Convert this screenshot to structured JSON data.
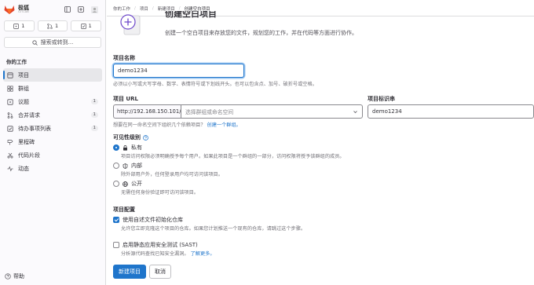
{
  "brand": {
    "name": "极狐",
    "subtitle": "GITLAB"
  },
  "sidebar": {
    "counters": [
      {
        "icon": "issues-icon",
        "count": "1"
      },
      {
        "icon": "merge-request-icon",
        "count": "1"
      },
      {
        "icon": "todo-icon",
        "count": "1"
      }
    ],
    "search_label": "搜索或转到...",
    "section_title": "你的工作",
    "items": [
      {
        "label": "项目",
        "icon": "project-icon",
        "active": true
      },
      {
        "label": "群组",
        "icon": "group-icon"
      },
      {
        "label": "议题",
        "icon": "issues-icon",
        "badge": "1"
      },
      {
        "label": "合并请求",
        "icon": "merge-request-icon",
        "badge": "1"
      },
      {
        "label": "待办事项列表",
        "icon": "todo-icon",
        "badge": "1"
      },
      {
        "label": "里程碑",
        "icon": "milestone-icon"
      },
      {
        "label": "代码片段",
        "icon": "snippet-icon"
      },
      {
        "label": "动态",
        "icon": "activity-icon"
      }
    ],
    "help_label": "帮助"
  },
  "breadcrumb": [
    "你的工作",
    "项目",
    "新建项目",
    "创建空白项目"
  ],
  "hero": {
    "title": "创建空白项目",
    "description": "创建一个空白项目来存放您的文件，规划您的工作，并在代码等方面进行协作。"
  },
  "form": {
    "name_label": "项目名称",
    "name_value": "demo1234",
    "name_help": "必须以小写或大写字母、数字、表情符号或下划线开头。也可以包含点、加号、破折号或空格。",
    "url_label": "项目 URL",
    "url_prefix": "http://192.168.150.101/",
    "namespace_placeholder": "选择群组或命名空间",
    "slug_label": "项目标识串",
    "slug_value": "demo1234",
    "group_hint_prefix": "想要在同一命名空间下组织几个依赖项目？",
    "group_hint_link": "创建一个群组。",
    "visibility_label": "可见性级别",
    "visibility_options": [
      {
        "label": "私有",
        "icon": "lock-icon",
        "desc": "项目访问权限必须明确授予每个用户。如果此项目是一个群组的一部分，访问权限将授予该群组的成员。",
        "checked": true
      },
      {
        "label": "内部",
        "icon": "shield-icon",
        "desc": "除外部用户外，任何登录用户均可访问该项目。",
        "checked": false
      },
      {
        "label": "公开",
        "icon": "globe-icon",
        "desc": "无需任何身份验证即可访问该项目。",
        "checked": false
      }
    ],
    "config_label": "项目配置",
    "config_options": [
      {
        "label": "使用自述文件初始化仓库",
        "desc": "允许您立即克隆这个项目的仓库。如果您计划推送一个现有的仓库，请跳过这个步骤。",
        "checked": true
      },
      {
        "label": "启用静态应用安全测试 (SAST)",
        "desc": "分析源代码查找已知安全漏洞。",
        "link": "了解更多。",
        "checked": false
      }
    ],
    "submit_label": "新建项目",
    "cancel_label": "取消"
  }
}
